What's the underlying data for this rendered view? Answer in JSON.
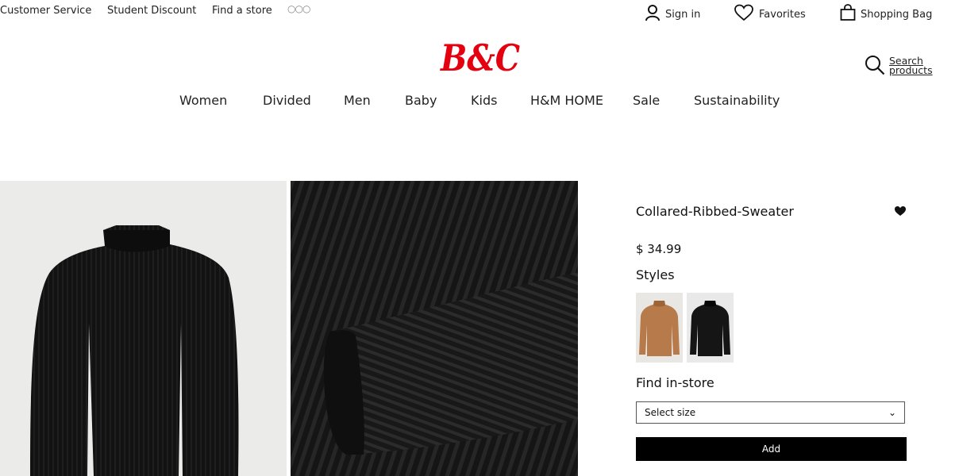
{
  "top_links": {
    "customer_service": "Customer Service",
    "student_discount": "Student Discount",
    "find_store": "Find a store",
    "more": "○○○"
  },
  "utility": {
    "sign_in": "Sign in",
    "favorites": "Favorites",
    "shopping_bag": "Shopping Bag"
  },
  "brand": {
    "logo_text": "B&C",
    "color": "#e50010"
  },
  "search": {
    "label": "Search products"
  },
  "nav": [
    {
      "label": "Women"
    },
    {
      "label": "Divided"
    },
    {
      "label": "Men"
    },
    {
      "label": "Baby"
    },
    {
      "label": "Kids"
    },
    {
      "label": "H&M HOME"
    },
    {
      "label": "Sale"
    },
    {
      "label": "Sustainability"
    }
  ],
  "product": {
    "title": "Collared-Ribbed-Sweater",
    "price": "$ 34.99",
    "styles_label": "Styles",
    "styles": [
      {
        "name": "camel-sweater-swatch",
        "color": "#b77a4a"
      },
      {
        "name": "black-sweater-swatch",
        "color": "#151515"
      }
    ],
    "find_in_store": "Find in-store",
    "size_select": {
      "value": "Select size",
      "chevron": "⌄"
    },
    "add_label": "Add"
  },
  "icons": {
    "user": "user-icon",
    "heart": "heart-icon",
    "bag": "shopping-bag-icon",
    "search": "search-icon",
    "favorite_filled": "heart-filled-icon"
  }
}
